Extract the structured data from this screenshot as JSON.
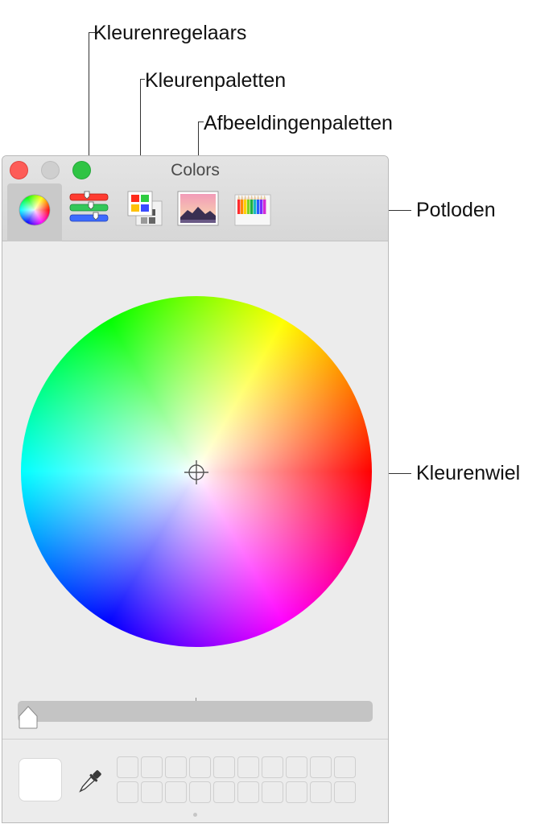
{
  "callouts": {
    "sliders": "Kleurenregelaars",
    "palettes": "Kleurenpaletten",
    "images": "Afbeeldingenpaletten",
    "pencils": "Potloden",
    "wheel": "Kleurenwiel"
  },
  "window": {
    "title": "Colors",
    "traffic_colors": {
      "close": "#fd5c57",
      "minimize": "#cfcfcf",
      "zoom": "#2fc444"
    },
    "tabs": [
      {
        "icon": "color-wheel-icon",
        "selected": true
      },
      {
        "icon": "color-sliders-icon",
        "selected": false
      },
      {
        "icon": "color-palettes-icon",
        "selected": false
      },
      {
        "icon": "image-palettes-icon",
        "selected": false
      },
      {
        "icon": "pencils-icon",
        "selected": false
      }
    ]
  },
  "wheel": {
    "center_icon": "crosshair-icon"
  },
  "brightness_slider": {
    "value": 0
  },
  "bottom": {
    "current_color": "#ffffff",
    "tool_icon": "eyedropper-icon",
    "swatch_grid": {
      "columns": 10,
      "rows": 2
    }
  }
}
